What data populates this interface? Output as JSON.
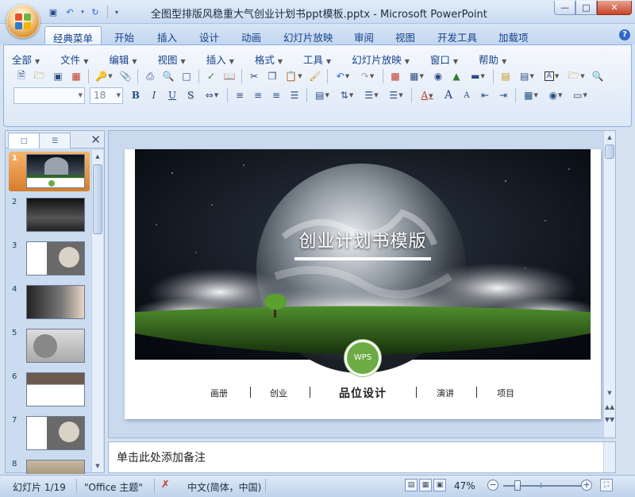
{
  "window": {
    "title": "全图型排版风稳重大气创业计划书ppt模板.pptx - Microsoft PowerPoint",
    "controls": {
      "minimize": "—",
      "maximize": "□",
      "close": "✕"
    }
  },
  "quick_access": [
    "save-icon",
    "undo-icon",
    "redo-icon",
    "customize-icon"
  ],
  "tabs": [
    {
      "label": "经典菜单",
      "active": true
    },
    {
      "label": "开始"
    },
    {
      "label": "插入"
    },
    {
      "label": "设计"
    },
    {
      "label": "动画"
    },
    {
      "label": "幻灯片放映"
    },
    {
      "label": "审阅"
    },
    {
      "label": "视图"
    },
    {
      "label": "开发工具"
    },
    {
      "label": "加载项"
    }
  ],
  "classic_menu": [
    "全部",
    "文件",
    "编辑",
    "视图",
    "插入",
    "格式",
    "工具",
    "幻灯片放映",
    "窗口",
    "帮助"
  ],
  "toolbar": {
    "font_name": "",
    "font_size": "18",
    "bold": "B",
    "italic": "I",
    "underline": "U",
    "shadow": "S",
    "font_color": "A",
    "grow": "A",
    "shrink": "A",
    "textbox": "A"
  },
  "left_panel": {
    "tab_slides_icon": "slide-thumb-icon",
    "tab_outline_icon": "outline-icon",
    "close": "✕",
    "slides": [
      {
        "num": "1",
        "selected": true
      },
      {
        "num": "2"
      },
      {
        "num": "3"
      },
      {
        "num": "4"
      },
      {
        "num": "5"
      },
      {
        "num": "6"
      },
      {
        "num": "7"
      },
      {
        "num": "8"
      }
    ]
  },
  "slide": {
    "title": "创业计划书模版",
    "badge": "WPS",
    "nav": [
      "画册",
      "创业",
      "品位设计",
      "演讲",
      "项目"
    ]
  },
  "notes": {
    "placeholder": "单击此处添加备注"
  },
  "status": {
    "slide_info": "幻灯片 1/19",
    "theme": "\"Office 主题\"",
    "language": "中文(简体，中国)",
    "zoom": "47%",
    "zoom_out": "−",
    "zoom_in": "+"
  },
  "colors": {
    "ribbon_blue": "#dce8f6",
    "accent_green": "#6dac45",
    "selected_thumb": "#e08a33"
  }
}
